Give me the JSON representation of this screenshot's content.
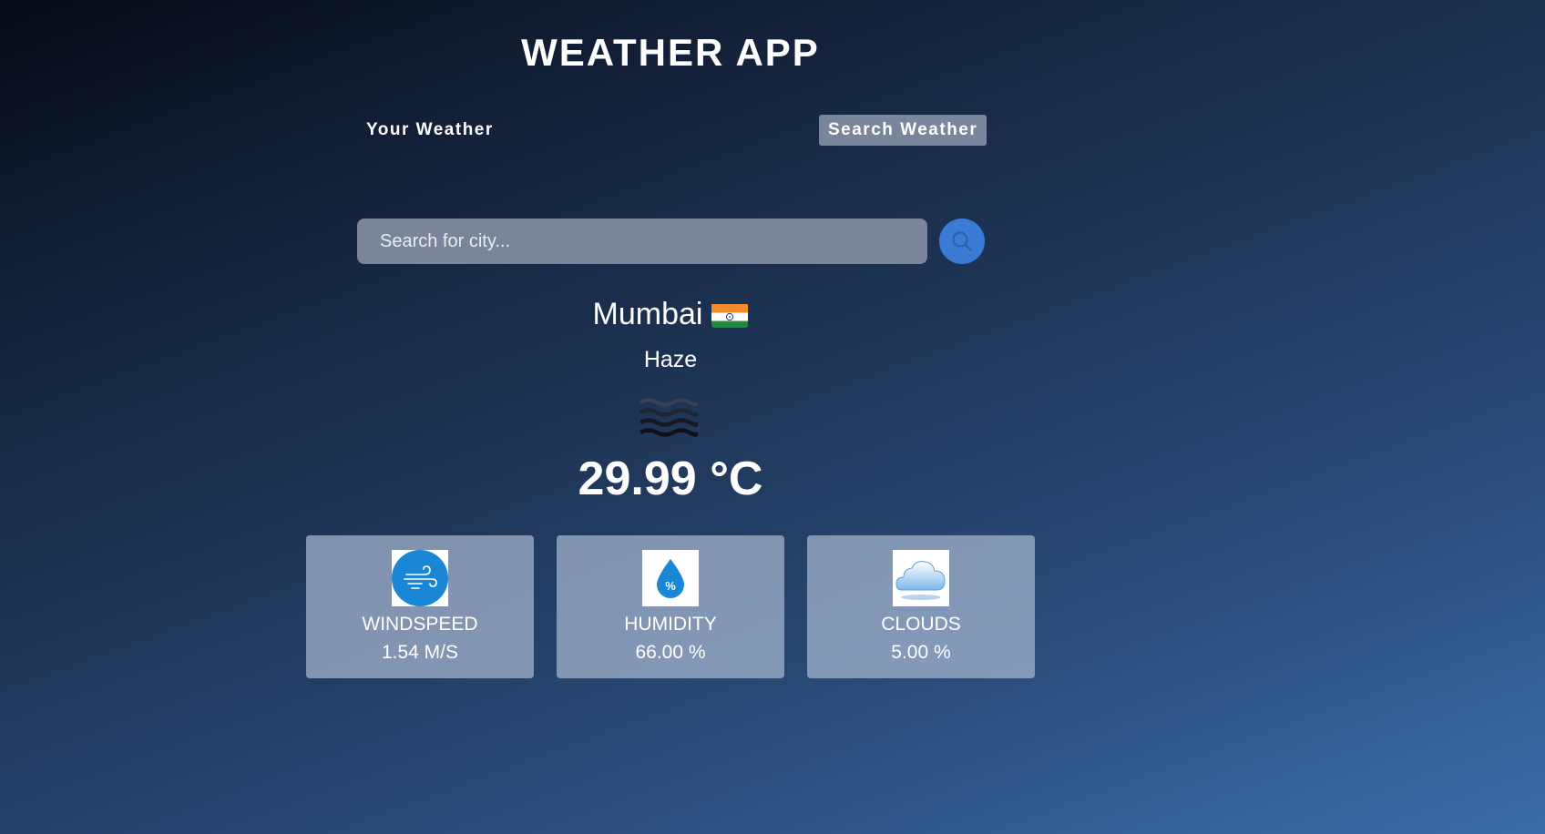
{
  "app": {
    "title": "WEATHER APP"
  },
  "tabs": [
    {
      "label": "Your Weather",
      "active": false
    },
    {
      "label": "Search Weather",
      "active": true
    }
  ],
  "search": {
    "placeholder": "Search for city...",
    "value": "",
    "button_icon": "search-icon"
  },
  "location": {
    "city": "Mumbai",
    "flag": "india-flag"
  },
  "weather": {
    "description": "Haze",
    "icon": "haze-icon",
    "temperature": "29.99 °C"
  },
  "stats": [
    {
      "label": "WINDSPEED",
      "value": "1.54 M/S",
      "icon": "wind-icon"
    },
    {
      "label": "HUMIDITY",
      "value": "66.00 %",
      "icon": "humidity-icon"
    },
    {
      "label": "CLOUDS",
      "value": "5.00 %",
      "icon": "cloud-icon"
    }
  ],
  "colors": {
    "accent": "#3b7bd6",
    "card_bg": "#8a9ab8",
    "input_bg": "#7a8599"
  }
}
